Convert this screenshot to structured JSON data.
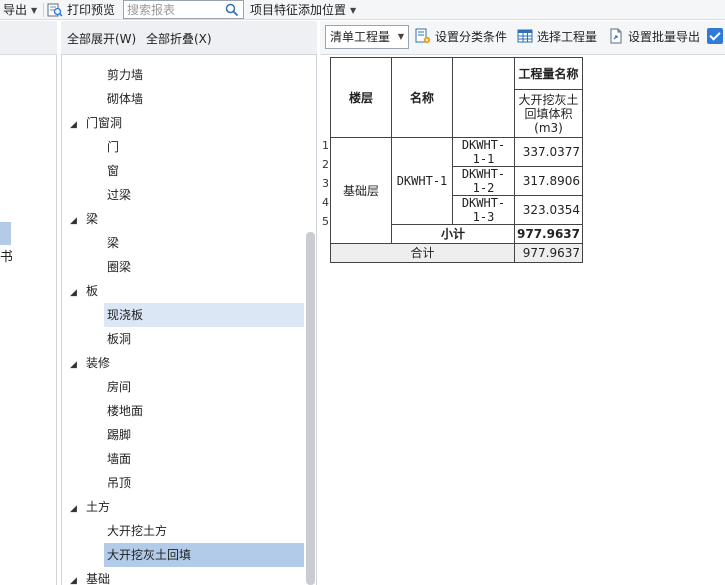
{
  "toolbar": {
    "export_label": "导出",
    "print_preview_label": "打印预览",
    "search_placeholder": "搜索报表",
    "feature_position_label": "项目特征添加位置"
  },
  "left_strip": {
    "partial_text": "书"
  },
  "tree": {
    "expand_all_label": "全部展开(W)",
    "collapse_all_label": "全部折叠(X)",
    "nodes": [
      {
        "label": "剪力墙",
        "level": 1
      },
      {
        "label": "砌体墙",
        "level": 1
      },
      {
        "label": "门窗洞",
        "level": 0
      },
      {
        "label": "门",
        "level": 1
      },
      {
        "label": "窗",
        "level": 1
      },
      {
        "label": "过梁",
        "level": 1
      },
      {
        "label": "梁",
        "level": 0
      },
      {
        "label": "梁",
        "level": 1
      },
      {
        "label": "圈梁",
        "level": 1
      },
      {
        "label": "板",
        "level": 0
      },
      {
        "label": "现浇板",
        "level": 1,
        "state": "hover"
      },
      {
        "label": "板洞",
        "level": 1
      },
      {
        "label": "装修",
        "level": 0
      },
      {
        "label": "房间",
        "level": 1
      },
      {
        "label": "楼地面",
        "level": 1
      },
      {
        "label": "踢脚",
        "level": 1
      },
      {
        "label": "墙面",
        "level": 1
      },
      {
        "label": "吊顶",
        "level": 1
      },
      {
        "label": "土方",
        "level": 0
      },
      {
        "label": "大开挖土方",
        "level": 1
      },
      {
        "label": "大开挖灰土回填",
        "level": 1,
        "state": "selected"
      },
      {
        "label": "基础",
        "level": 0
      }
    ]
  },
  "report_toolbar": {
    "quantity_type_selected": "清单工程量",
    "set_classify_label": "设置分类条件",
    "select_quantity_label": "选择工程量",
    "set_batch_export_label": "设置批量导出"
  },
  "report": {
    "header": {
      "floor": "楼层",
      "name": "名称",
      "quantity_name": "工程量名称",
      "quantity_column": "大开挖灰土回填体积(m3)"
    },
    "row_numbers": [
      "1",
      "2",
      "3",
      "4",
      "5"
    ],
    "floor_value": "基础层",
    "name_value": "DKWHT-1",
    "rows": [
      {
        "code": "DKWHT-1-1",
        "value": "337.0377"
      },
      {
        "code": "DKWHT-1-2",
        "value": "317.8906"
      },
      {
        "code": "DKWHT-1-3",
        "value": "323.0354"
      }
    ],
    "subtotal_label": "小计",
    "subtotal_value": "977.9637",
    "total_label": "合计",
    "total_value": "977.9637"
  }
}
